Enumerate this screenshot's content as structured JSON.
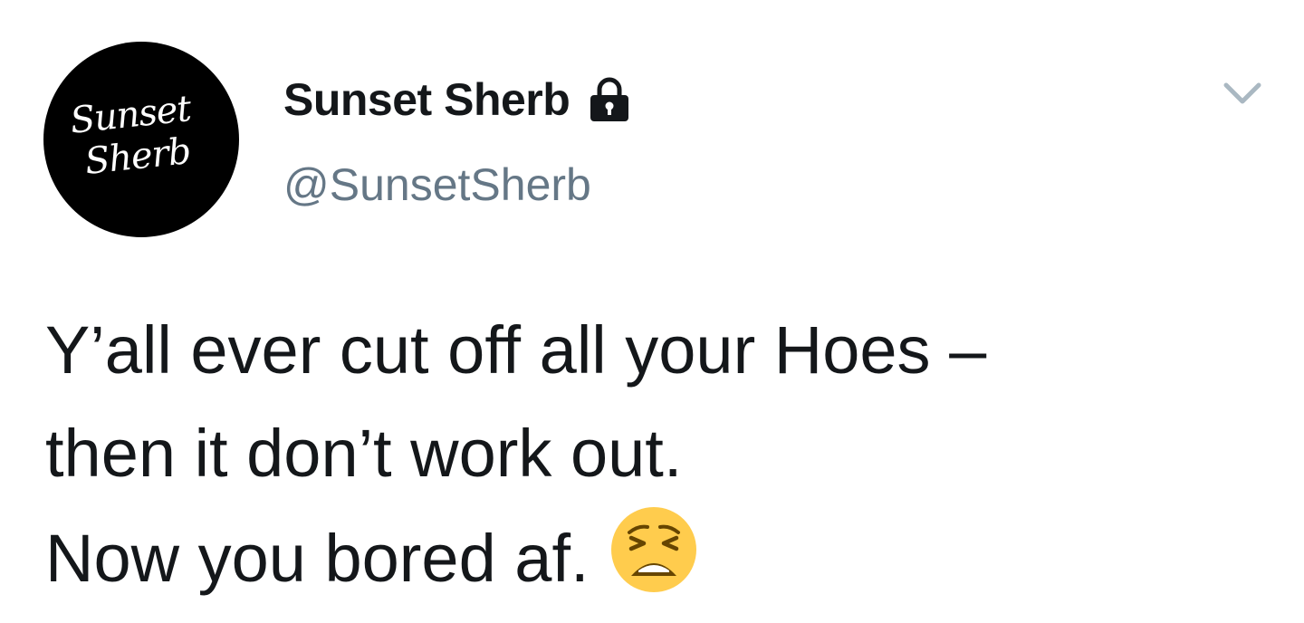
{
  "author": {
    "avatar_text_line1": "Sunset",
    "avatar_text_line2": "Sherb",
    "display_name": "Sunset Sherb",
    "handle": "@SunsetSherb",
    "protected_icon": "lock-icon"
  },
  "menu": {
    "icon": "chevron-down-icon"
  },
  "tweet": {
    "lines": [
      "Y’all ever cut off all your Hoes –",
      "then it don’t work out.",
      "Now you bored af."
    ],
    "emoji": "weary-face-emoji"
  },
  "colors": {
    "text": "#14171a",
    "secondary_text": "#657786",
    "chevron": "#aab8c2",
    "emoji_fill": "#ffcc4d",
    "avatar_bg": "#000000"
  }
}
